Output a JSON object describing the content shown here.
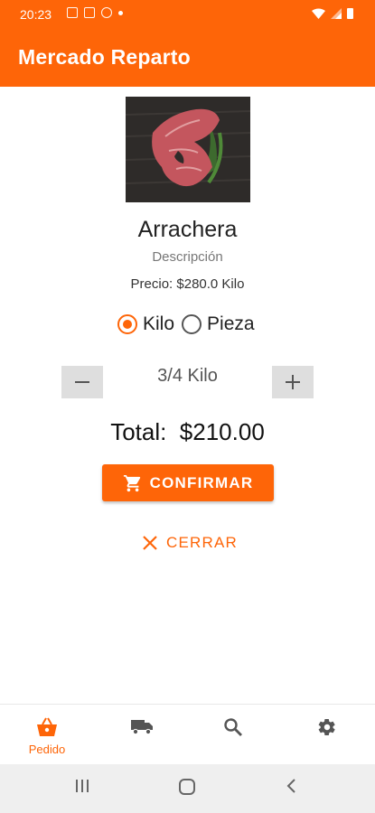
{
  "status_bar": {
    "time": "20:23"
  },
  "app_bar": {
    "title": "Mercado Reparto"
  },
  "product": {
    "image_alt": "arrachera-photo",
    "name": "Arrachera",
    "description": "Descripción",
    "price": "Precio: $280.0 Kilo"
  },
  "unit_options": [
    {
      "label": "Kilo",
      "selected": true
    },
    {
      "label": "Pieza",
      "selected": false
    }
  ],
  "quantity": {
    "value": "3/4 Kilo"
  },
  "total": {
    "text": "Total:  $210.00"
  },
  "actions": {
    "confirm_label": "CONFIRMAR",
    "close_label": "CERRAR"
  },
  "bottom_nav": [
    {
      "label": "Pedido",
      "icon": "basket-icon",
      "active": true
    },
    {
      "label": "",
      "icon": "truck-icon",
      "active": false
    },
    {
      "label": "",
      "icon": "search-icon",
      "active": false
    },
    {
      "label": "",
      "icon": "gear-icon",
      "active": false
    }
  ],
  "colors": {
    "accent": "#fe6508",
    "inactive_icon": "#555555"
  }
}
